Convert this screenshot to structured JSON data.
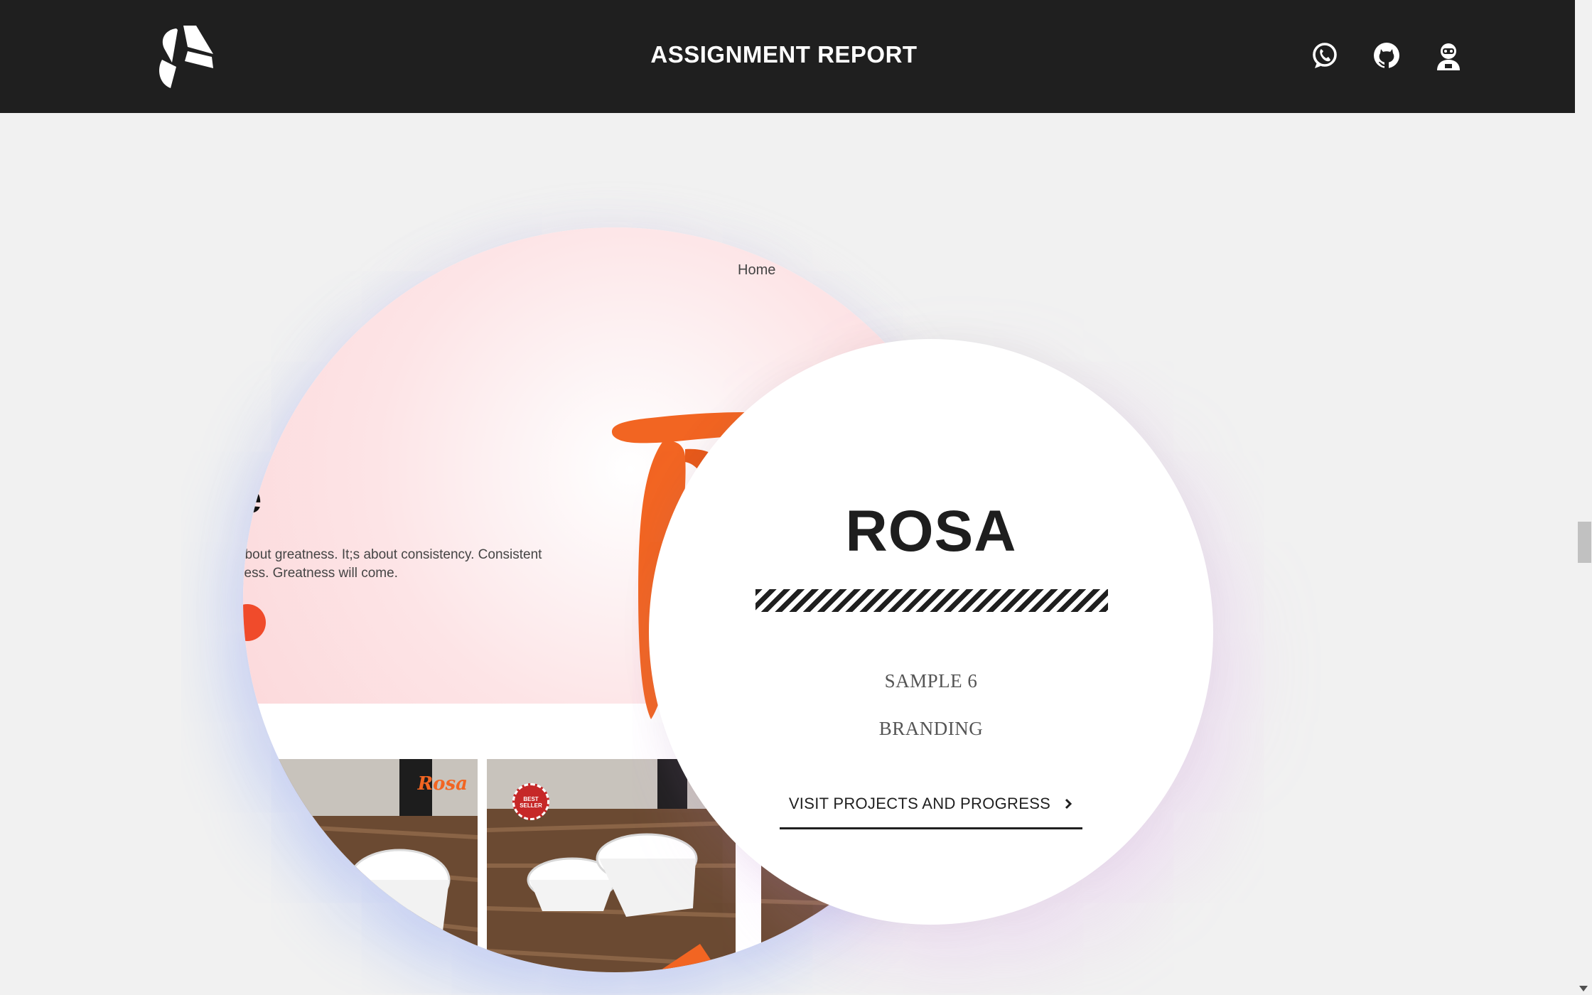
{
  "header": {
    "title": "ASSIGNMENT REPORT",
    "logo_icon": "initials-logo-icon",
    "icons": [
      "whatsapp-icon",
      "github-icon",
      "user-avatar-icon"
    ],
    "background": "#1f1f1f",
    "text_color": "#ffffff"
  },
  "preview": {
    "breadcrumb": "Home",
    "breadcrumb_separator": ".",
    "heading_fragment": "e",
    "body_text_line1": "about greatness. It;s about consistency. Consistent",
    "body_text_line2": "cess. Greatness will come.",
    "cards": [
      {
        "brand": "Rosa"
      },
      {
        "badge": "BEST SELLER"
      },
      {}
    ],
    "accent_color": "#f26522",
    "hero_tint": "#fcd7d9"
  },
  "project": {
    "name": "ROSA",
    "sample": "SAMPLE 6",
    "category": "BRANDING",
    "cta_label": "VISIT PROJECTS AND PROGRESS",
    "cta_icon": "chevron-right-icon"
  }
}
